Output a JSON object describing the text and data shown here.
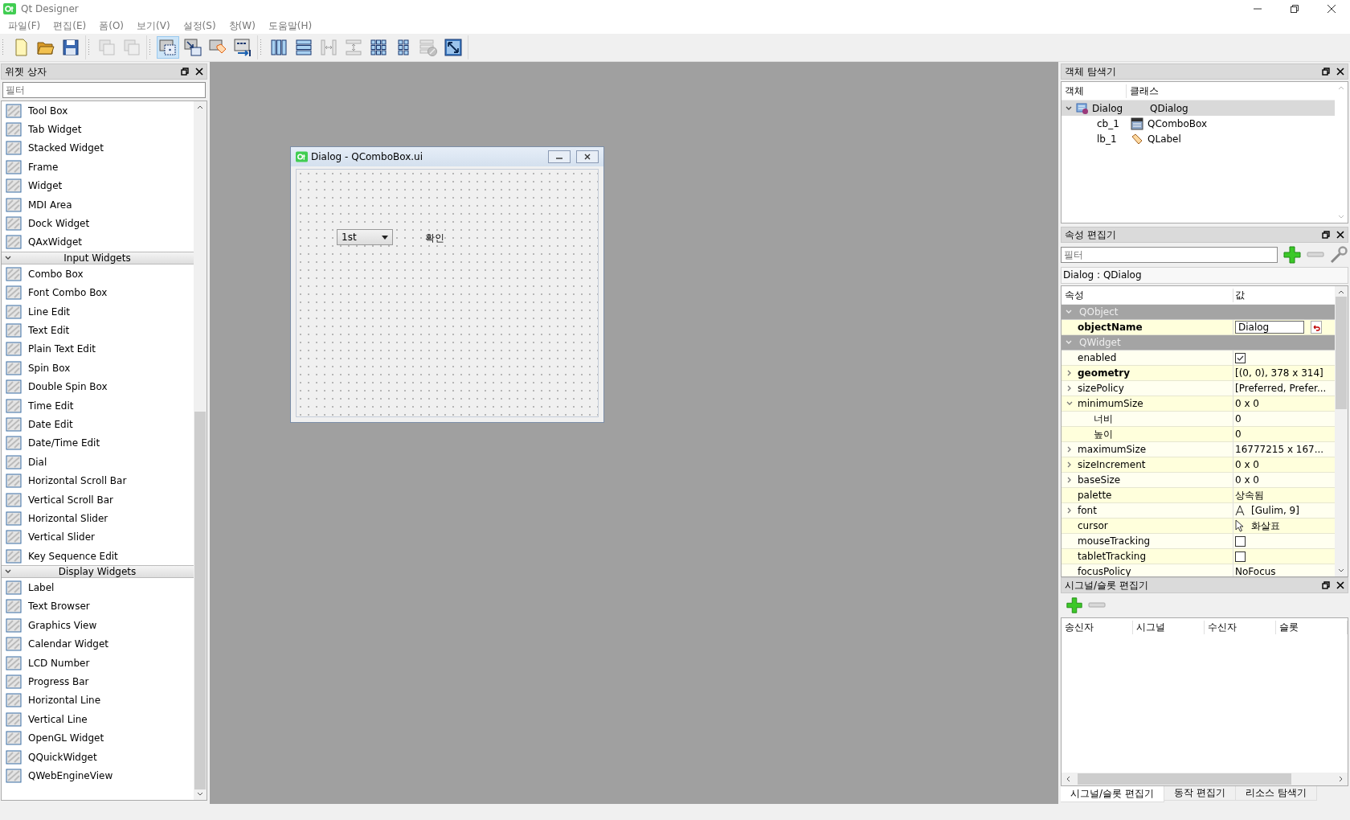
{
  "window": {
    "title": "Qt Designer"
  },
  "menu": [
    "파일(F)",
    "편집(E)",
    "폼(O)",
    "보기(V)",
    "설정(S)",
    "창(W)",
    "도움말(H)"
  ],
  "toolbar": [
    {
      "buttons": [
        {
          "kind": "new",
          "selected": false,
          "disabled": false
        },
        {
          "kind": "open",
          "selected": false,
          "disabled": false
        },
        {
          "kind": "save",
          "selected": false,
          "disabled": false
        }
      ]
    },
    {
      "buttons": [
        {
          "kind": "back",
          "selected": false,
          "disabled": true
        },
        {
          "kind": "front",
          "selected": false,
          "disabled": true
        }
      ]
    },
    {
      "buttons": [
        {
          "kind": "edit_widgets",
          "selected": true,
          "disabled": false
        },
        {
          "kind": "edit_signals",
          "selected": false,
          "disabled": false
        },
        {
          "kind": "edit_buddies",
          "selected": false,
          "disabled": false
        },
        {
          "kind": "edit_tab_order",
          "selected": false,
          "disabled": false
        }
      ]
    },
    {
      "buttons": [
        {
          "kind": "lay_h",
          "selected": false,
          "disabled": false
        },
        {
          "kind": "lay_v",
          "selected": false,
          "disabled": false
        },
        {
          "kind": "split_h",
          "selected": false,
          "disabled": true
        },
        {
          "kind": "split_v",
          "selected": false,
          "disabled": true
        },
        {
          "kind": "grid",
          "selected": false,
          "disabled": false
        },
        {
          "kind": "form",
          "selected": false,
          "disabled": false
        },
        {
          "kind": "break",
          "selected": false,
          "disabled": true
        },
        {
          "kind": "adjust",
          "selected": false,
          "disabled": false
        }
      ]
    }
  ],
  "widget_box": {
    "title": "위젯 상자",
    "filter": {
      "placeholder": "필터"
    },
    "sections": [
      {
        "items": [
          "Tool Box",
          "Tab Widget",
          "Stacked Widget",
          "Frame",
          "Widget",
          "MDI Area",
          "Dock Widget",
          "QAxWidget"
        ]
      },
      {
        "title": "Input Widgets",
        "expanded": true,
        "items": [
          "Combo Box",
          "Font Combo Box",
          "Line Edit",
          "Text Edit",
          "Plain Text Edit",
          "Spin Box",
          "Double Spin Box",
          "Time Edit",
          "Date Edit",
          "Date/Time Edit",
          "Dial",
          "Horizontal Scroll Bar",
          "Vertical Scroll Bar",
          "Horizontal Slider",
          "Vertical Slider",
          "Key Sequence Edit"
        ]
      },
      {
        "title": "Display Widgets",
        "expanded": true,
        "items": [
          "Label",
          "Text Browser",
          "Graphics View",
          "Calendar Widget",
          "LCD Number",
          "Progress Bar",
          "Horizontal Line",
          "Vertical Line",
          "OpenGL Widget",
          "QQuickWidget",
          "QWebEngineView"
        ]
      }
    ]
  },
  "form_window": {
    "title": "Dialog - QComboBox.ui",
    "combo_value": "1st",
    "label": "확인"
  },
  "object_inspector": {
    "title": "객체 탐색기",
    "columns": [
      "객체",
      "클래스"
    ],
    "tree": [
      {
        "name": "Dialog",
        "class": "QDialog",
        "kind": "dialog",
        "selected": true,
        "expanded": true,
        "children": [
          {
            "name": "cb_1",
            "class": "QComboBox",
            "kind": "combo",
            "selected": false
          },
          {
            "name": "lb_1",
            "class": "QLabel",
            "kind": "label",
            "selected": false
          }
        ]
      }
    ]
  },
  "property_editor": {
    "title": "속성 편집기",
    "filter": {
      "placeholder": "필터"
    },
    "context": "Dialog : QDialog",
    "columns": [
      "속성",
      "값"
    ],
    "rows": [
      {
        "kind": "group",
        "name": "QObject",
        "expanded": true,
        "children": [
          {
            "kind": "edit",
            "name": "objectName",
            "value": "Dialog",
            "modified": true
          }
        ]
      },
      {
        "kind": "group",
        "name": "QWidget",
        "expanded": true,
        "children": [
          {
            "kind": "checkbox",
            "name": "enabled",
            "checked": true,
            "modified": false
          },
          {
            "kind": "text",
            "name": "geometry",
            "value": "[(0, 0), 378 x 314]",
            "modified": true,
            "expanded": false
          },
          {
            "kind": "text",
            "name": "sizePolicy",
            "value": "[Preferred, Prefer...",
            "modified": false,
            "expanded": false
          },
          {
            "kind": "text",
            "name": "minimumSize",
            "value": "0 x 0",
            "modified": false,
            "expanded": true,
            "children": [
              {
                "kind": "text",
                "name": "너비",
                "value": "0",
                "modified": false
              },
              {
                "kind": "text",
                "name": "높이",
                "value": "0",
                "modified": false
              }
            ]
          },
          {
            "kind": "text",
            "name": "maximumSize",
            "value": "16777215 x 167...",
            "modified": false,
            "expanded": false
          },
          {
            "kind": "text",
            "name": "sizeIncrement",
            "value": "0 x 0",
            "modified": false,
            "expanded": false
          },
          {
            "kind": "text",
            "name": "baseSize",
            "value": "0 x 0",
            "modified": false,
            "expanded": false
          },
          {
            "kind": "text",
            "name": "palette",
            "value": "상속됨",
            "modified": false
          },
          {
            "kind": "font",
            "name": "font",
            "value": "[Gulim, 9]",
            "modified": false,
            "expanded": false
          },
          {
            "kind": "cursor",
            "name": "cursor",
            "value": "화살표",
            "modified": false
          },
          {
            "kind": "checkbox",
            "name": "mouseTracking",
            "checked": false,
            "modified": false
          },
          {
            "kind": "checkbox",
            "name": "tabletTracking",
            "checked": false,
            "modified": false
          },
          {
            "kind": "text",
            "name": "focusPolicy",
            "value": "NoFocus",
            "modified": false
          }
        ]
      }
    ]
  },
  "signal_slot_editor": {
    "title": "시그널/슬롯 편집기",
    "columns": [
      "송신자",
      "시그널",
      "수신자",
      "슬롯"
    ],
    "tabs": [
      {
        "label": "시그널/슬롯 편집기",
        "selected": true
      },
      {
        "label": "동작 편집기",
        "selected": false
      },
      {
        "label": "리소스 탐색기",
        "selected": false
      }
    ]
  }
}
